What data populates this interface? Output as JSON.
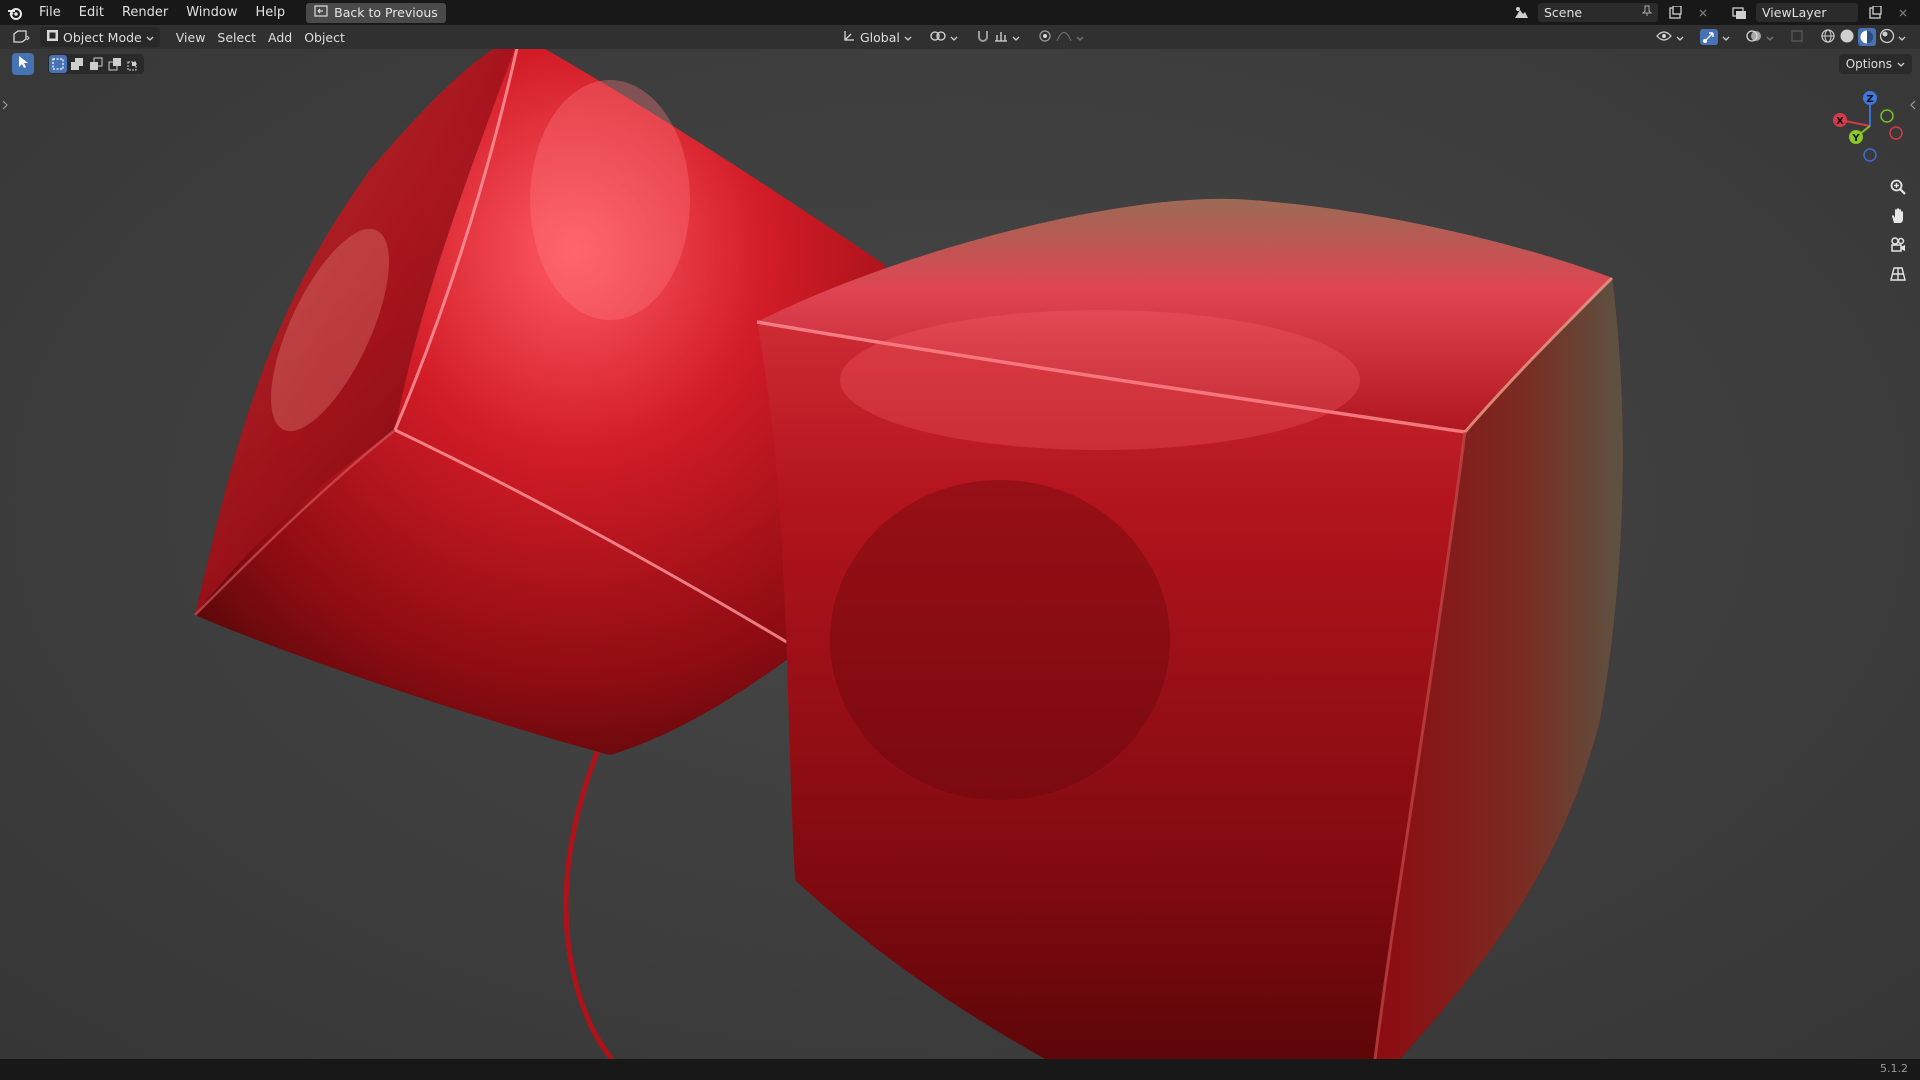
{
  "topbar": {
    "menus": [
      "File",
      "Edit",
      "Render",
      "Window",
      "Help"
    ],
    "back_label": "Back to Previous",
    "scene_name": "Scene",
    "view_layer": "ViewLayer"
  },
  "header": {
    "mode_label": "Object Mode",
    "menus": [
      "View",
      "Select",
      "Add",
      "Object"
    ],
    "orientation": "Global"
  },
  "viewport": {
    "options_label": "Options",
    "gizmo_axes": [
      "Z",
      "X",
      "Y"
    ],
    "nav_icons": [
      "zoom-icon",
      "hand-pan-icon",
      "camera-icon",
      "grid-perspective-icon"
    ]
  },
  "status": {
    "version": "5.1.2"
  },
  "colors": {
    "balloon_red": "#c0141c",
    "accent_blue": "#4772b3"
  }
}
